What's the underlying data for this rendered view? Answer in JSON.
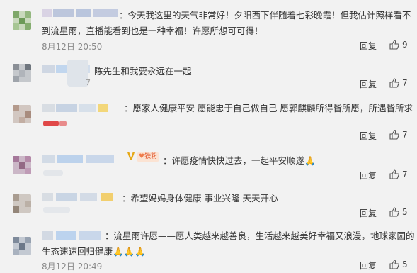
{
  "comments": [
    {
      "text_line1": "：今天我这里的天气非常好！夕阳西下伴随着七彩晚霞！但我估计照样看不",
      "text_line2": "到流星雨，直播能看到也是一种幸福！许愿所想可可得！",
      "time": "8月12日 20:50",
      "reply": "回复",
      "likes": "9"
    },
    {
      "text_line1": "陈先生和我要永远在一起",
      "fragment": "7",
      "reply": "回复",
      "likes": "7"
    },
    {
      "text_line1": "：愿家人健康平安 愿能忠于自己做自己 愿郭麒麟所得皆所愿，所遇皆所求",
      "reply": "回复",
      "likes": "7"
    },
    {
      "text_line1": "：许愿疫情快快过去，一起平安顺遂🙏",
      "badge_text": "铁粉",
      "reply": "回复",
      "likes": "7"
    },
    {
      "text_line1": "：希望妈妈身体健康 事业兴隆 天天开心",
      "reply": "回复",
      "likes": "5"
    },
    {
      "text_line1": "：流星雨许愿——愿人类越来越善良，生活越来越美好幸福又浪漫，地球家园的",
      "text_line2": "生态速速回归健康🙏🙏🙏",
      "time": "8月12日 20:49",
      "reply": "回复",
      "likes": "5"
    }
  ]
}
